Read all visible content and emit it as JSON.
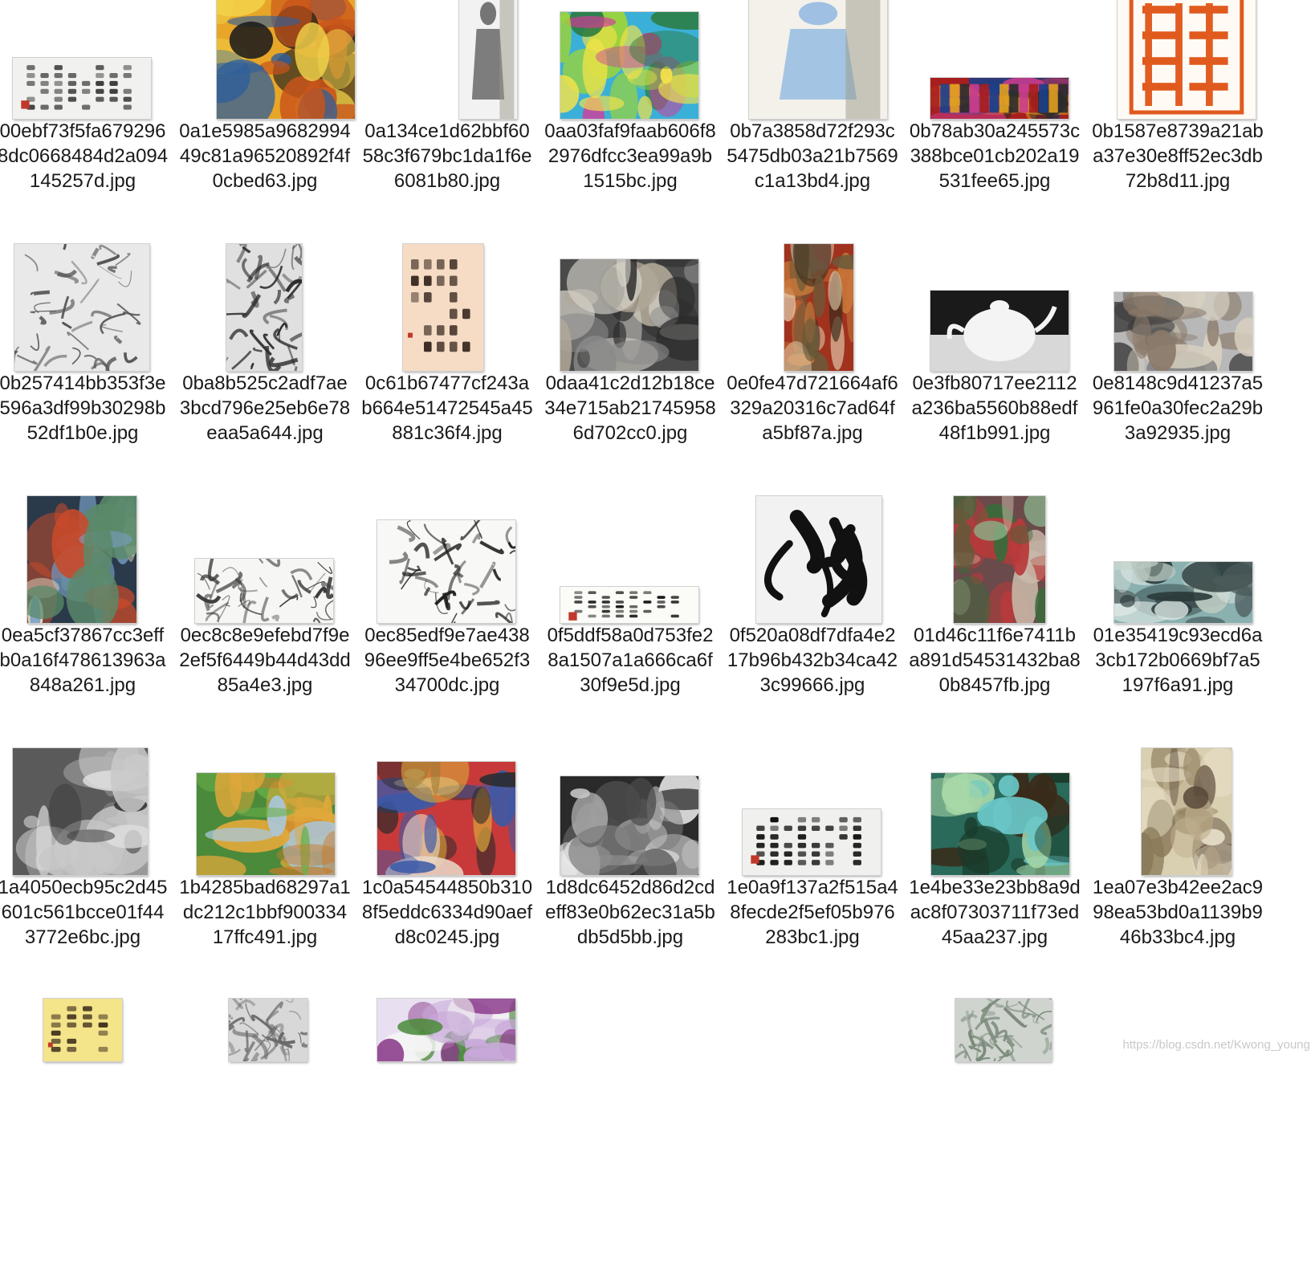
{
  "files": [
    {
      "name": "00ebf73f5fa6792968dc0668484d2a094145257d.jpg",
      "thumb": {
        "kind": "calligraphy",
        "bg": "#f1f1ef",
        "fg": "#3a3a3a"
      }
    },
    {
      "name": "0a1e5985a968299449c81a96520892f4f0cbed63.jpg",
      "thumb": {
        "kind": "painting",
        "colors": [
          "#e8a628",
          "#c9541a",
          "#2f5f9a",
          "#f2d34a",
          "#1b1b1b"
        ]
      }
    },
    {
      "name": "0a134ce1d62bbf6058c3f679bc1da1f6e6081b80.jpg",
      "thumb": {
        "kind": "figure",
        "bg": "#f2f2f2",
        "fg": "#555555"
      }
    },
    {
      "name": "0aa03faf9faab606f82976dfcc3ea99a9b1515bc.jpg",
      "thumb": {
        "kind": "painting",
        "colors": [
          "#3ab0d8",
          "#9bd33a",
          "#d63a9a",
          "#2c7a3a",
          "#f3e24a"
        ]
      }
    },
    {
      "name": "0b7a3858d72f293c5475db03a21b7569c1a13bd4.jpg",
      "thumb": {
        "kind": "figure",
        "bg": "#f4f1ea",
        "fg": "#8ab4e0"
      }
    },
    {
      "name": "0b78ab30a245573c388bce01cb202a19531fee65.jpg",
      "thumb": {
        "kind": "strip",
        "colors": [
          "#a81e1e",
          "#1c3f8a",
          "#e0a020",
          "#2b2b2b",
          "#c83c8c"
        ]
      }
    },
    {
      "name": "0b1587e8739a21aba37e30e8ff52ec3db72b8d11.jpg",
      "thumb": {
        "kind": "seal",
        "bg": "#fffaf4",
        "fg": "#e05a1e"
      }
    },
    {
      "name": "0b257414bb353f3e596a3df99b30298b52df1b0e.jpg",
      "thumb": {
        "kind": "landscape",
        "bg": "#e9e9e9",
        "fg": "#555555"
      }
    },
    {
      "name": "0ba8b525c2adf7ae3bcd796e25eb6e78eaa5a644.jpg",
      "thumb": {
        "kind": "landscape",
        "bg": "#e0e0e0",
        "fg": "#2c2c2c"
      }
    },
    {
      "name": "0c61b67477cf243ab664e51472545a45881c36f4.jpg",
      "thumb": {
        "kind": "calligraphy",
        "bg": "#f6dcc4",
        "fg": "#3a2a22"
      }
    },
    {
      "name": "0daa41c2d12b18ce34e715ab217459586d702cc0.jpg",
      "thumb": {
        "kind": "photo",
        "colors": [
          "#4a4a4a",
          "#d8d4cc",
          "#8a8a8a",
          "#2a2a2a",
          "#b0a898"
        ]
      }
    },
    {
      "name": "0e0fe47d721664af6329a20316c7ad64fa5bf87a.jpg",
      "thumb": {
        "kind": "painting",
        "colors": [
          "#a0321e",
          "#c8783a",
          "#6a5a3a",
          "#e8d8b8",
          "#3a2a1a"
        ]
      }
    },
    {
      "name": "0e3fb80717ee2112a236ba5560b88edf48f1b991.jpg",
      "thumb": {
        "kind": "teapot",
        "bg": "#1a1a1a",
        "fg": "#f4f4f4"
      }
    },
    {
      "name": "0e8148c9d41237a5961fe0a30fec2a29b3a92935.jpg",
      "thumb": {
        "kind": "painting",
        "colors": [
          "#b8b8b8",
          "#6a6a6a",
          "#3a3a3a",
          "#d8d0c0",
          "#8a7a6a"
        ]
      }
    },
    {
      "name": "0ea5cf37867cc3effb0a16f478613963a848a261.jpg",
      "thumb": {
        "kind": "painting",
        "colors": [
          "#2a3a4a",
          "#5a8a6a",
          "#e8e0c8",
          "#c84a2a",
          "#7aa0c8"
        ]
      }
    },
    {
      "name": "0ec8c8e9efebd7f9e2ef5f6449b44d43dd85a4e3.jpg",
      "thumb": {
        "kind": "sketch",
        "bg": "#f6f6f4",
        "fg": "#3a3a3a"
      }
    },
    {
      "name": "0ec85edf9e7ae43896ee9ff5e4be652f334700dc.jpg",
      "thumb": {
        "kind": "sketch",
        "bg": "#f8f8f6",
        "fg": "#1e1e1e"
      }
    },
    {
      "name": "0f5ddf58a0d753fe28a1507a1a666ca6f30f9e5d.jpg",
      "thumb": {
        "kind": "calligraphy",
        "bg": "#fbfbf7",
        "fg": "#1a1a1a"
      }
    },
    {
      "name": "0f520a08df7dfa4e217b96b432b34ca423c99666.jpg",
      "thumb": {
        "kind": "brush",
        "bg": "#f2f2f2",
        "fg": "#111111"
      }
    },
    {
      "name": "01d46c11f6e7411ba891d54531432ba80b8457fb.jpg",
      "thumb": {
        "kind": "painting",
        "colors": [
          "#6a4a4a",
          "#8ab08a",
          "#c8b8a8",
          "#3a6a3a",
          "#b83a3a"
        ]
      }
    },
    {
      "name": "01e35419c93ecd6a3cb172b0669bf7a5197f6a91.jpg",
      "thumb": {
        "kind": "painting",
        "colors": [
          "#8ab0b0",
          "#d8e4e0",
          "#4a5a5a",
          "#b8c8c0",
          "#2a3a3a"
        ]
      }
    },
    {
      "name": "1a4050ecb95c2d45601c561bcce01f443772e6bc.jpg",
      "thumb": {
        "kind": "photo",
        "colors": [
          "#5a5a5a",
          "#c8c8c8",
          "#3a3a3a",
          "#8a8a8a",
          "#e0e0e0"
        ]
      }
    },
    {
      "name": "1b4285bad68297a1dc212c1bbf90033417ffc491.jpg",
      "thumb": {
        "kind": "painting",
        "colors": [
          "#4a8a3a",
          "#e0a83a",
          "#a8c8e0",
          "#6ab04a",
          "#c87a2a"
        ]
      }
    },
    {
      "name": "1c0a54544850b3108f5eddc6334d90aefd8c0245.jpg",
      "thumb": {
        "kind": "painting",
        "colors": [
          "#c83a3a",
          "#3a5aa8",
          "#e8d8c8",
          "#2a2a2a",
          "#d8a83a"
        ]
      }
    },
    {
      "name": "1d8dc6452d86d2cdeff83e0b62ec31a5bdb5d5bb.jpg",
      "thumb": {
        "kind": "painting",
        "colors": [
          "#2a2a2a",
          "#7a7a7a",
          "#c8c8c8",
          "#4a4a4a",
          "#e8e8e8"
        ]
      }
    },
    {
      "name": "1e0a9f137a2f515a48fecde2f5ef05b976283bc1.jpg",
      "thumb": {
        "kind": "calligraphy",
        "bg": "#f0f0ee",
        "fg": "#111111"
      }
    },
    {
      "name": "1e4be33e23bb8a9dac8f07303711f73ed45aa237.jpg",
      "thumb": {
        "kind": "painting",
        "colors": [
          "#2a6a5a",
          "#6ac8c8",
          "#3a2a1a",
          "#a8d8a8",
          "#1a3a2a"
        ]
      }
    },
    {
      "name": "1ea07e3b42ee2ac998ea53bd0a1139b946b33bc4.jpg",
      "thumb": {
        "kind": "painting",
        "colors": [
          "#d8d0b0",
          "#8a7a5a",
          "#e8e0c8",
          "#5a4a3a",
          "#c0b090"
        ]
      }
    },
    {
      "name": "",
      "thumb": {
        "kind": "calligraphy",
        "bg": "#f4e48a",
        "fg": "#3a2a1a"
      }
    },
    {
      "name": "",
      "thumb": {
        "kind": "landscape",
        "bg": "#d8d8d8",
        "fg": "#6a6a6a"
      }
    },
    {
      "name": "",
      "thumb": {
        "kind": "painting",
        "colors": [
          "#e8e0f0",
          "#8a3a8a",
          "#4a8a3a",
          "#f4f4f4",
          "#c8a8d8"
        ]
      }
    },
    {
      "name": "",
      "thumb": null
    },
    {
      "name": "",
      "thumb": null
    },
    {
      "name": "",
      "thumb": {
        "kind": "landscape",
        "bg": "#cfd4cf",
        "fg": "#7a8a7a"
      }
    },
    {
      "name": "",
      "thumb": null
    }
  ],
  "watermark": "https://blog.csdn.net/Kwong_young"
}
